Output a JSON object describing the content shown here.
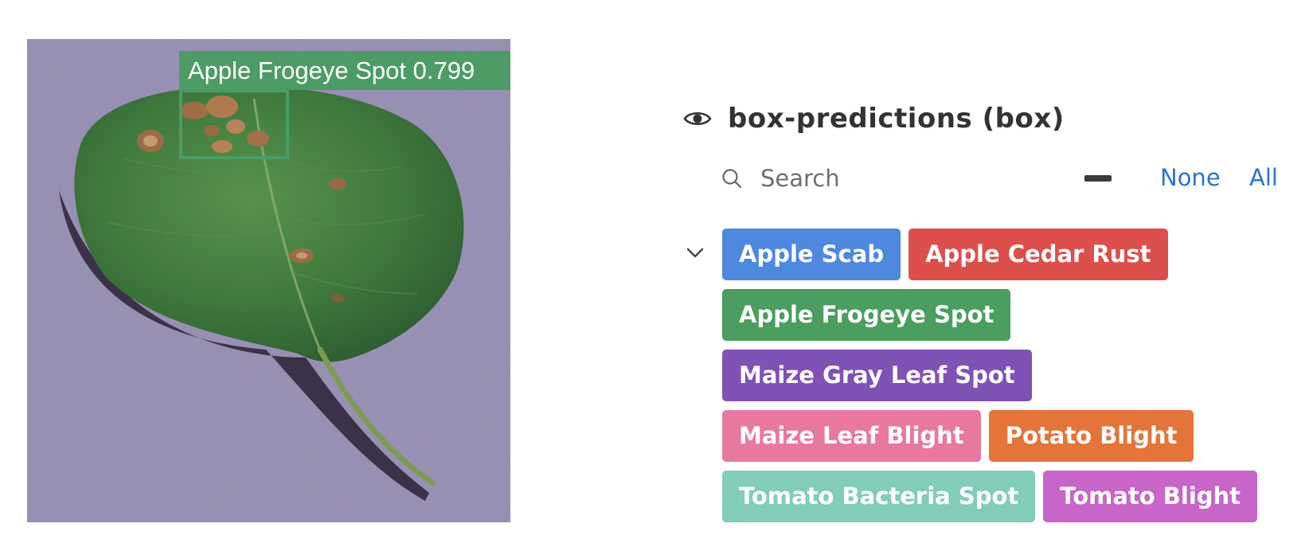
{
  "image": {
    "detection_label": "Apple Frogeye Spot 0.799",
    "box_color": "#4d9b65"
  },
  "layer": {
    "icon": "eye-icon",
    "title": "box-predictions (box)"
  },
  "search": {
    "icon": "search-icon",
    "placeholder": "Search",
    "value": ""
  },
  "toggle": {
    "minus_icon": "minus-icon",
    "none_label": "None",
    "all_label": "All",
    "link_color": "#2d74c9"
  },
  "tags": [
    {
      "label": "Apple Scab",
      "color": "#4e88df"
    },
    {
      "label": "Apple Cedar Rust",
      "color": "#dd4f4b"
    },
    {
      "label": "Apple Frogeye Spot",
      "color": "#4b9e5f"
    },
    {
      "label": "Maize Gray Leaf Spot",
      "color": "#7f52b6"
    },
    {
      "label": "Maize Leaf Blight",
      "color": "#e978a1"
    },
    {
      "label": "Potato Blight",
      "color": "#e57439"
    },
    {
      "label": "Tomato Bacteria Spot",
      "color": "#82cdb9"
    },
    {
      "label": "Tomato Blight",
      "color": "#c765c9"
    }
  ]
}
